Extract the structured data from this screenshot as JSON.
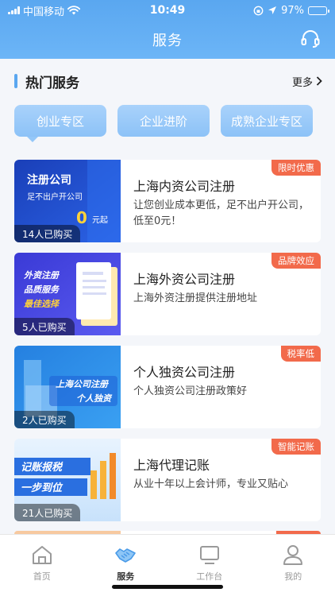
{
  "status": {
    "carrier": "中国移动",
    "time": "10:49",
    "battery": "97%"
  },
  "header": {
    "title": "服务",
    "support_icon": "headset-icon"
  },
  "section": {
    "title": "热门服务",
    "more": "更多"
  },
  "categories": [
    {
      "label": "创业专区"
    },
    {
      "label": "企业进阶"
    },
    {
      "label": "成熟企业专区"
    }
  ],
  "cards": [
    {
      "title": "上海内资公司注册",
      "desc": "让您创业成本更低，足不出户开公司，低至0元！",
      "badge": "限时优惠",
      "buyers": "14人已购买",
      "thumb": {
        "line1": "注册公司",
        "line2": "足不出户开公司",
        "num": "0",
        "unit": "元起"
      }
    },
    {
      "title": "上海外资公司注册",
      "desc": "上海外资注册提供注册地址",
      "badge": "品牌效应",
      "buyers": "5人已购买",
      "thumb": {
        "line1": "外资注册",
        "line2": "品质服务",
        "line3": "最佳选择"
      }
    },
    {
      "title": "个人独资公司注册",
      "desc": "个人独资公司注册政策好",
      "badge": "税率低",
      "buyers": "2人已购买",
      "thumb": {
        "line1": "上海公司注册",
        "line2": "个人独资"
      }
    },
    {
      "title": "上海代理记账",
      "desc": "从业十年以上会计师，专业又贴心",
      "badge": "智能记账",
      "buyers": "21人已购买",
      "thumb": {
        "line1": "记账报税",
        "line2": "一步到位"
      }
    }
  ],
  "tabs": [
    {
      "label": "首页",
      "icon": "home-icon"
    },
    {
      "label": "服务",
      "icon": "handshake-icon"
    },
    {
      "label": "工作台",
      "icon": "monitor-icon"
    },
    {
      "label": "我的",
      "icon": "user-icon"
    }
  ],
  "colors": {
    "primary": "#5aa7f0",
    "badge": "#f26a4b",
    "pill": "#94c7f8"
  }
}
